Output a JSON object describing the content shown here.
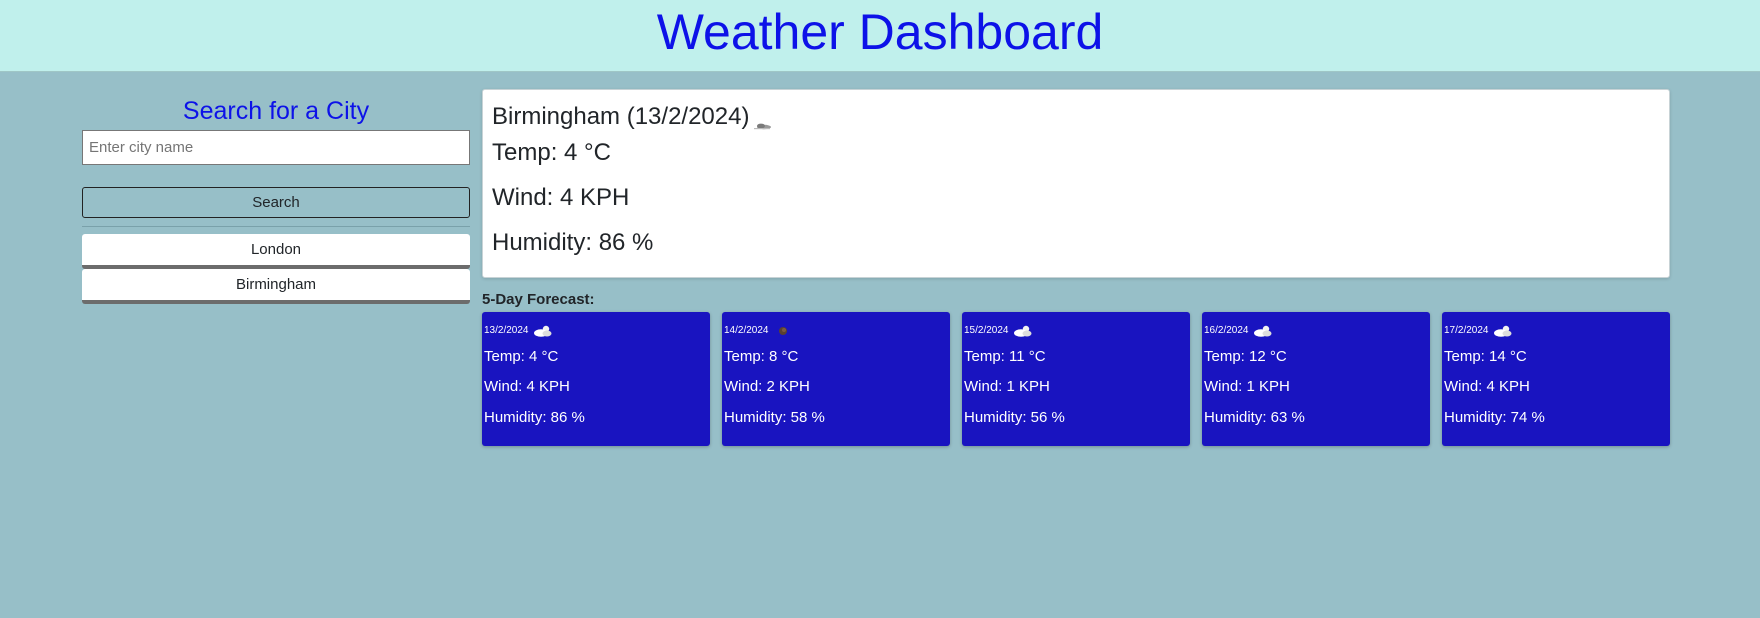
{
  "header": {
    "title": "Weather Dashboard"
  },
  "sidebar": {
    "heading": "Search for a City",
    "search_placeholder": "Enter city name",
    "search_value": "",
    "search_button": "Search",
    "history": [
      "London",
      "Birmingham"
    ]
  },
  "current": {
    "city_date": "Birmingham (13/2/2024)",
    "icon": "cloudy-wind-icon",
    "temp": "Temp: 4 °C",
    "wind": "Wind: 4 KPH",
    "humidity": "Humidity: 86 %"
  },
  "forecast": {
    "title": "5-Day Forecast:",
    "days": [
      {
        "date": "13/2/2024",
        "icon": "partly-cloudy-icon",
        "temp": "Temp: 4 °C",
        "wind": "Wind: 4 KPH",
        "humidity": "Humidity: 86 %"
      },
      {
        "date": "14/2/2024",
        "icon": "dark-cloud-icon",
        "temp": "Temp: 8 °C",
        "wind": "Wind: 2 KPH",
        "humidity": "Humidity: 58 %"
      },
      {
        "date": "15/2/2024",
        "icon": "partly-cloudy-icon",
        "temp": "Temp: 11 °C",
        "wind": "Wind: 1 KPH",
        "humidity": "Humidity: 56 %"
      },
      {
        "date": "16/2/2024",
        "icon": "partly-cloudy-icon",
        "temp": "Temp: 12 °C",
        "wind": "Wind: 1 KPH",
        "humidity": "Humidity: 63 %"
      },
      {
        "date": "17/2/2024",
        "icon": "partly-cloudy-icon",
        "temp": "Temp: 14 °C",
        "wind": "Wind: 4 KPH",
        "humidity": "Humidity: 74 %"
      }
    ]
  },
  "colors": {
    "page_bg": "#97bfc8",
    "header_bg": "#c0f0ec",
    "heading_blue": "#0d12e8",
    "card_blue": "#1914c0"
  }
}
